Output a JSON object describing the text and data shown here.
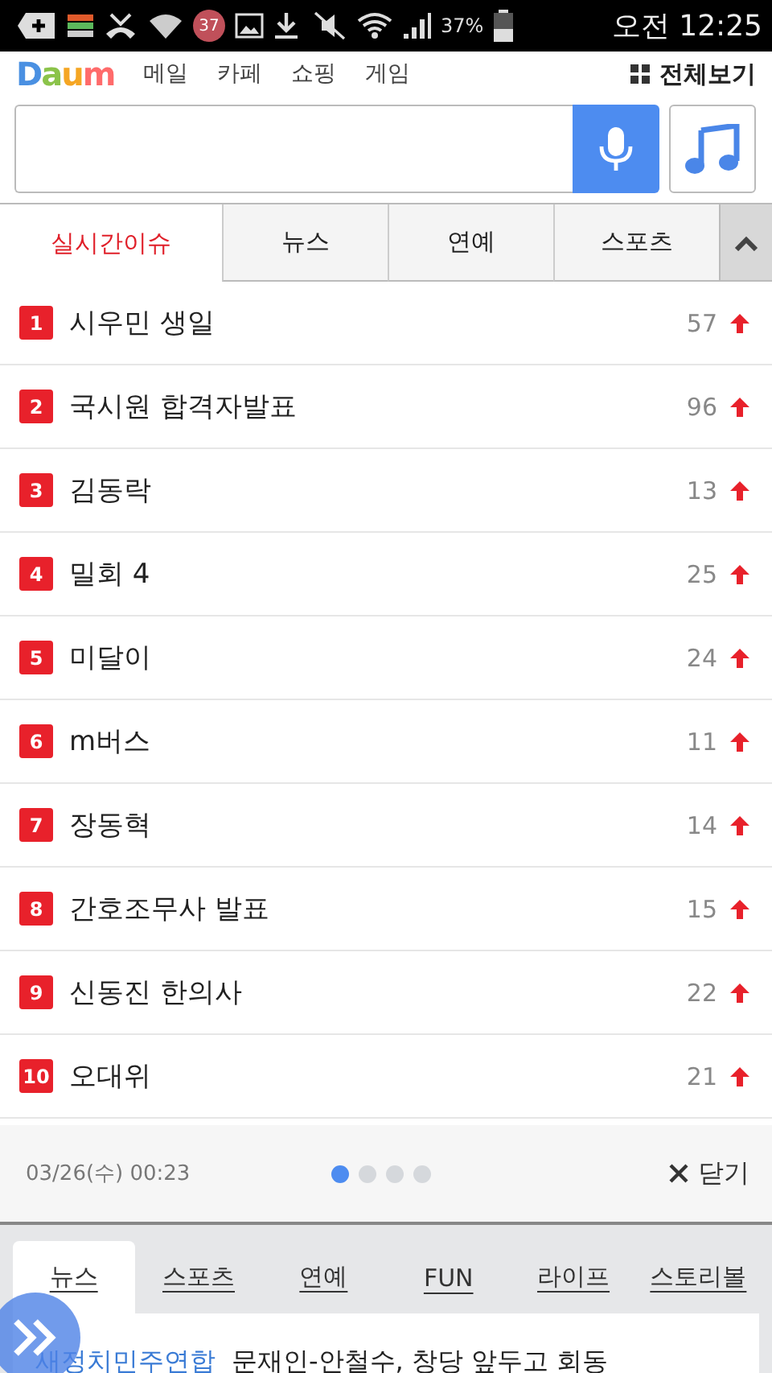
{
  "status_bar": {
    "notification_badge": "37",
    "battery": "37%",
    "time": "오전 12:25"
  },
  "header": {
    "logo": "Daum",
    "nav": [
      "메일",
      "카페",
      "쇼핑",
      "게임"
    ],
    "all_menu": "전체보기"
  },
  "tabs": [
    {
      "label": "실시간이슈",
      "selected": true
    },
    {
      "label": "뉴스",
      "selected": false
    },
    {
      "label": "연예",
      "selected": false
    },
    {
      "label": "스포츠",
      "selected": false
    }
  ],
  "ranking": [
    {
      "rank": "1",
      "title": "시우민 생일",
      "count": "57",
      "rising": true
    },
    {
      "rank": "2",
      "title": "국시원 합격자발표",
      "count": "96",
      "rising": true
    },
    {
      "rank": "3",
      "title": "김동락",
      "count": "13",
      "rising": true
    },
    {
      "rank": "4",
      "title": "밀회 4",
      "count": "25",
      "rising": true
    },
    {
      "rank": "5",
      "title": "미달이",
      "count": "24",
      "rising": true
    },
    {
      "rank": "6",
      "title": "m버스",
      "count": "11",
      "rising": true
    },
    {
      "rank": "7",
      "title": "장동혁",
      "count": "14",
      "rising": true
    },
    {
      "rank": "8",
      "title": "간호조무사 발표",
      "count": "15",
      "rising": true
    },
    {
      "rank": "9",
      "title": "신동진 한의사",
      "count": "22",
      "rising": true
    },
    {
      "rank": "10",
      "title": "오대위",
      "count": "21",
      "rising": true
    }
  ],
  "ranking_footer": {
    "timestamp": "03/26(수) 00:23",
    "pages": [
      {
        "selected": true
      },
      {
        "selected": false
      },
      {
        "selected": false
      },
      {
        "selected": false
      }
    ],
    "close": "닫기"
  },
  "bottom_tabs": [
    {
      "label": "뉴스",
      "selected": true
    },
    {
      "label": "스포츠",
      "selected": false
    },
    {
      "label": "연예",
      "selected": false
    },
    {
      "label": "FUN",
      "selected": false
    },
    {
      "label": "라이프",
      "selected": false
    },
    {
      "label": "스토리볼",
      "selected": false
    }
  ],
  "headline": {
    "category": "새정치민주연합",
    "title": "문재인-안철수, 창당 앞두고 회동"
  }
}
